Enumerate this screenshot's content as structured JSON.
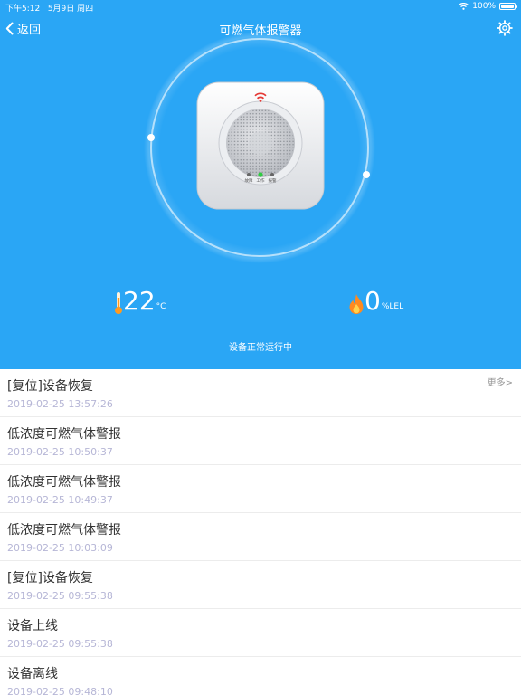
{
  "status_bar": {
    "time": "下午5:12",
    "date": "5月9日 周四",
    "battery_percent": "100%",
    "battery_level": 1.0
  },
  "nav": {
    "back_label": "返回",
    "title": "可燃气体报警器"
  },
  "device": {
    "indicator_labels": [
      "故障",
      "工作",
      "报警"
    ]
  },
  "readings": {
    "temperature": {
      "value": "22",
      "unit": "°C"
    },
    "gas": {
      "value": "0",
      "unit": "%LEL"
    }
  },
  "device_status": "设备正常运行中",
  "events": {
    "more_label": "更多>",
    "items": [
      {
        "title": "[复位]设备恢复",
        "time": "2019-02-25 13:57:26"
      },
      {
        "title": "低浓度可燃气体警报",
        "time": "2019-02-25 10:50:37"
      },
      {
        "title": "低浓度可燃气体警报",
        "time": "2019-02-25 10:49:37"
      },
      {
        "title": "低浓度可燃气体警报",
        "time": "2019-02-25 10:03:09"
      },
      {
        "title": "[复位]设备恢复",
        "time": "2019-02-25 09:55:38"
      },
      {
        "title": "设备上线",
        "time": "2019-02-25 09:55:38"
      },
      {
        "title": "设备离线",
        "time": "2019-02-25 09:48:10"
      }
    ]
  },
  "colors": {
    "primary": "#2aa6f5",
    "alarm_red": "#e53935",
    "work_green": "#2ecc40",
    "time_text": "#b6b6d6"
  }
}
